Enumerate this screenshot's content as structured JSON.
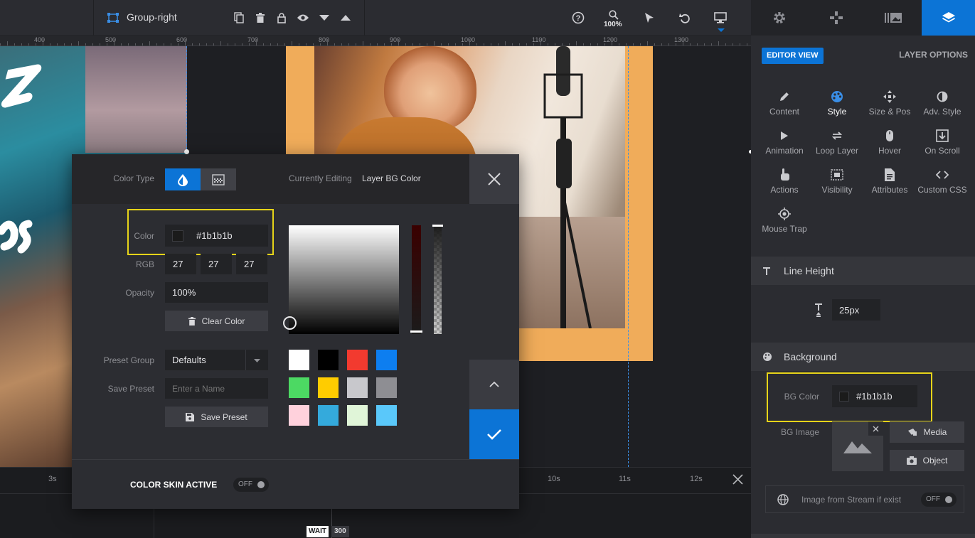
{
  "toolbar": {
    "group_name": "Group-right",
    "zoom": "100%"
  },
  "ruler": {
    "numbers": [
      "400",
      "500",
      "600",
      "700",
      "800",
      "900",
      "1000",
      "1100",
      "1200",
      "1300"
    ]
  },
  "timeline": {
    "markers": [
      "3s",
      "10s",
      "11s",
      "12s"
    ],
    "wait_label": "WAIT",
    "wait_value": "300"
  },
  "panel": {
    "editor_view": "EDITOR VIEW",
    "layer_options": "LAYER OPTIONS",
    "options": [
      {
        "label": "Content",
        "icon": "pencil-icon"
      },
      {
        "label": "Style",
        "icon": "palette-icon",
        "active": true
      },
      {
        "label": "Size & Pos",
        "icon": "move-icon"
      },
      {
        "label": "Adv. Style",
        "icon": "contrast-icon"
      },
      {
        "label": "Animation",
        "icon": "play-icon"
      },
      {
        "label": "Loop Layer",
        "icon": "loop-icon"
      },
      {
        "label": "Hover",
        "icon": "mouse-icon"
      },
      {
        "label": "On Scroll",
        "icon": "scroll-icon"
      },
      {
        "label": "Actions",
        "icon": "hand-icon"
      },
      {
        "label": "Visibility",
        "icon": "visibility-icon"
      },
      {
        "label": "Attributes",
        "icon": "document-icon"
      },
      {
        "label": "Custom CSS",
        "icon": "code-icon"
      },
      {
        "label": "Mouse Trap",
        "icon": "target-icon"
      }
    ],
    "line_height": {
      "title": "Line Height",
      "value": "25px"
    },
    "background": {
      "title": "Background",
      "bg_color_label": "BG Color",
      "bg_color_value": "#1b1b1b",
      "bg_image_label": "BG Image",
      "media_button": "Media",
      "object_button": "Object",
      "stream_label": "Image from Stream if exist",
      "stream_toggle": "OFF"
    }
  },
  "color_popup": {
    "color_type_label": "Color Type",
    "currently_editing_label": "Currently Editing",
    "currently_editing_value": "Layer BG Color",
    "color_label": "Color",
    "color_value": "#1b1b1b",
    "rgb_label": "RGB",
    "r": "27",
    "g": "27",
    "b": "27",
    "opacity_label": "Opacity",
    "opacity_value": "100%",
    "clear_color": "Clear Color",
    "preset_group_label": "Preset Group",
    "preset_group_value": "Defaults",
    "save_preset_label": "Save Preset",
    "save_preset_placeholder": "Enter a Name",
    "save_preset_button": "Save Preset",
    "color_skin_label": "COLOR SKIN ACTIVE",
    "color_skin_toggle": "OFF",
    "swatches": [
      "#ffffff",
      "#000000",
      "#f23a2f",
      "#0d7ef0",
      "#4cd963",
      "#ffcc00",
      "#c8c8cc",
      "#8e8e93",
      "#ffd1dc",
      "#34aadc",
      "#e0f5d8",
      "#5ac8fa"
    ]
  },
  "colors": {
    "accent": "#0c74d6",
    "highlight": "#e6d419",
    "frame": "#f0ac5a"
  }
}
